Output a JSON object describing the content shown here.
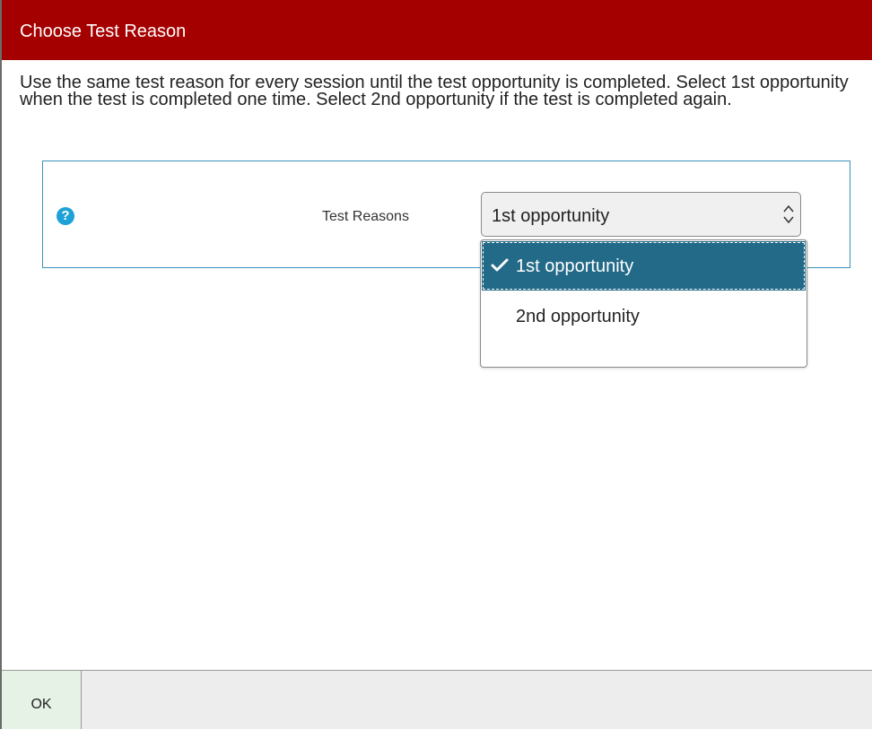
{
  "dialog": {
    "title": "Choose Test Reason",
    "instructions": "Use the same test reason for every session until the test opportunity is completed. Select 1st opportunity when the test is completed one time. Select 2nd opportunity if the test is completed again.",
    "title_bar_color": "#a50000"
  },
  "form": {
    "help_icon": "question-icon",
    "help_glyph": "?",
    "field_label": "Test Reasons",
    "select_value": "1st opportunity",
    "options": [
      {
        "label": "1st opportunity",
        "selected": true
      },
      {
        "label": "2nd opportunity",
        "selected": false
      }
    ],
    "selected_color": "#226a87",
    "panel_border_color": "#3a93b8"
  },
  "footer": {
    "ok_label": "OK",
    "ok_bg_color": "#e6f2e6"
  }
}
